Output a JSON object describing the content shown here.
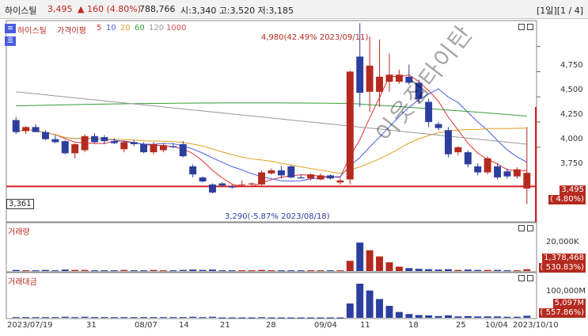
{
  "header": {
    "name": "하이스틸",
    "price": "3,495",
    "change": "▲ 160 (4.80%)",
    "volume": "788,766",
    "ohl": "시:3,340 고:3,520 저:3,185",
    "period": "[1일][1 / 4]"
  },
  "legend": {
    "name": "하이스틸",
    "price_label": "가격이평",
    "ma": [
      "5",
      "10",
      "20",
      "60",
      "120",
      "1000"
    ]
  },
  "colors": {
    "up": "#b52a1f",
    "down": "#2d3f9e",
    "ma5": "#e03030",
    "ma10": "#4a5de0",
    "ma20": "#e0a020",
    "ma60": "#3a9a3a",
    "ma120": "#999999",
    "ma1000": "#e05050"
  },
  "annotations": {
    "high": "4,980(42.49% 2023/09/11)",
    "low": "3,290(-5.87% 2023/08/18)"
  },
  "price_panel": {
    "yticks": [
      "4,750",
      "4,500",
      "4,250",
      "4,000",
      "3,750"
    ],
    "left_value": "3,361",
    "current_price": "3,495",
    "current_change": "( 4.80%)"
  },
  "volume_panel": {
    "title": "거래량",
    "ytick": "20,000K",
    "value": "1,378,468",
    "pct": "( 530.83%)"
  },
  "amount_panel": {
    "title": "거래대금",
    "ytick": "100,000M",
    "value": "5,097M",
    "pct": "( 557.86%)"
  },
  "xticks": [
    "2023/07/19",
    "31",
    "08/07",
    "14",
    "21",
    "28",
    "09/04",
    "11",
    "18",
    "25",
    "10/04",
    "2023/10/10"
  ],
  "watermark": "이웃집타이탄",
  "chart_data": {
    "type": "candlestick",
    "ylim": [
      3150,
      4960
    ],
    "candles": [
      {
        "o": 4020,
        "h": 4050,
        "l": 3880,
        "c": 3900
      },
      {
        "o": 3910,
        "h": 3960,
        "l": 3880,
        "c": 3950
      },
      {
        "o": 3950,
        "h": 3980,
        "l": 3900,
        "c": 3900
      },
      {
        "o": 3900,
        "h": 3920,
        "l": 3820,
        "c": 3830
      },
      {
        "o": 3830,
        "h": 3870,
        "l": 3790,
        "c": 3800
      },
      {
        "o": 3810,
        "h": 3820,
        "l": 3680,
        "c": 3690
      },
      {
        "o": 3690,
        "h": 3790,
        "l": 3640,
        "c": 3780
      },
      {
        "o": 3720,
        "h": 3880,
        "l": 3700,
        "c": 3860
      },
      {
        "o": 3860,
        "h": 3890,
        "l": 3790,
        "c": 3800
      },
      {
        "o": 3850,
        "h": 3870,
        "l": 3780,
        "c": 3810
      },
      {
        "o": 3810,
        "h": 3840,
        "l": 3780,
        "c": 3790
      },
      {
        "o": 3730,
        "h": 3810,
        "l": 3700,
        "c": 3800
      },
      {
        "o": 3800,
        "h": 3820,
        "l": 3760,
        "c": 3780
      },
      {
        "o": 3780,
        "h": 3800,
        "l": 3690,
        "c": 3700
      },
      {
        "o": 3700,
        "h": 3800,
        "l": 3680,
        "c": 3780
      },
      {
        "o": 3720,
        "h": 3790,
        "l": 3700,
        "c": 3770
      },
      {
        "o": 3760,
        "h": 3790,
        "l": 3740,
        "c": 3750
      },
      {
        "o": 3780,
        "h": 3810,
        "l": 3650,
        "c": 3660
      },
      {
        "o": 3560,
        "h": 3580,
        "l": 3450,
        "c": 3480
      },
      {
        "o": 3450,
        "h": 3460,
        "l": 3400,
        "c": 3410
      },
      {
        "o": 3380,
        "h": 3390,
        "l": 3290,
        "c": 3300
      },
      {
        "o": 3390,
        "h": 3400,
        "l": 3360,
        "c": 3370
      },
      {
        "o": 3360,
        "h": 3380,
        "l": 3340,
        "c": 3350
      },
      {
        "o": 3380,
        "h": 3420,
        "l": 3360,
        "c": 3380
      },
      {
        "o": 3380,
        "h": 3400,
        "l": 3360,
        "c": 3390
      },
      {
        "o": 3380,
        "h": 3520,
        "l": 3370,
        "c": 3500
      },
      {
        "o": 3490,
        "h": 3540,
        "l": 3480,
        "c": 3520
      },
      {
        "o": 3520,
        "h": 3560,
        "l": 3440,
        "c": 3470
      },
      {
        "o": 3560,
        "h": 3570,
        "l": 3440,
        "c": 3450
      },
      {
        "o": 3450,
        "h": 3480,
        "l": 3440,
        "c": 3440
      },
      {
        "o": 3440,
        "h": 3490,
        "l": 3420,
        "c": 3480
      },
      {
        "o": 3430,
        "h": 3490,
        "l": 3420,
        "c": 3470
      },
      {
        "o": 3470,
        "h": 3480,
        "l": 3430,
        "c": 3440
      },
      {
        "o": 3400,
        "h": 3440,
        "l": 3380,
        "c": 3420
      },
      {
        "o": 3430,
        "h": 4510,
        "l": 3380,
        "c": 4500
      },
      {
        "o": 4650,
        "h": 4980,
        "l": 4150,
        "c": 4290
      },
      {
        "o": 4300,
        "h": 4850,
        "l": 4100,
        "c": 4560
      },
      {
        "o": 4300,
        "h": 4820,
        "l": 4150,
        "c": 4450
      },
      {
        "o": 4400,
        "h": 4680,
        "l": 4300,
        "c": 4470
      },
      {
        "o": 4400,
        "h": 4520,
        "l": 4380,
        "c": 4470
      },
      {
        "o": 4450,
        "h": 4570,
        "l": 4370,
        "c": 4390
      },
      {
        "o": 4390,
        "h": 4420,
        "l": 4180,
        "c": 4230
      },
      {
        "o": 4200,
        "h": 4230,
        "l": 3950,
        "c": 4000
      },
      {
        "o": 3980,
        "h": 4000,
        "l": 3920,
        "c": 3940
      },
      {
        "o": 3920,
        "h": 3950,
        "l": 3650,
        "c": 3680
      },
      {
        "o": 3700,
        "h": 3760,
        "l": 3670,
        "c": 3750
      },
      {
        "o": 3700,
        "h": 3720,
        "l": 3550,
        "c": 3580
      },
      {
        "o": 3560,
        "h": 3590,
        "l": 3470,
        "c": 3500
      },
      {
        "o": 3500,
        "h": 3660,
        "l": 3480,
        "c": 3640
      },
      {
        "o": 3560,
        "h": 3590,
        "l": 3430,
        "c": 3450
      },
      {
        "o": 3510,
        "h": 3540,
        "l": 3440,
        "c": 3460
      },
      {
        "o": 3460,
        "h": 3550,
        "l": 3440,
        "c": 3530
      },
      {
        "o": 3340,
        "h": 3950,
        "l": 3185,
        "c": 3495
      }
    ],
    "volume": [
      3,
      2,
      2,
      3,
      2,
      4,
      3,
      3,
      2,
      2,
      2,
      3,
      2,
      2,
      3,
      2,
      2,
      3,
      4,
      3,
      4,
      2,
      2,
      2,
      2,
      3,
      2,
      2,
      2,
      2,
      2,
      2,
      2,
      2,
      28,
      78,
      57,
      40,
      24,
      12,
      8,
      6,
      5,
      4,
      5,
      3,
      4,
      3,
      3,
      3,
      2,
      2,
      5
    ],
    "amount": [
      2,
      2,
      2,
      2,
      2,
      3,
      2,
      3,
      2,
      2,
      2,
      2,
      2,
      2,
      2,
      2,
      2,
      2,
      3,
      2,
      3,
      1,
      1,
      1,
      1,
      2,
      1,
      1,
      1,
      1,
      1,
      1,
      1,
      1,
      42,
      100,
      80,
      55,
      35,
      17,
      11,
      8,
      7,
      5,
      7,
      4,
      5,
      4,
      4,
      4,
      3,
      3,
      6
    ],
    "volume_ymax": 100,
    "amount_ymax": 100
  }
}
